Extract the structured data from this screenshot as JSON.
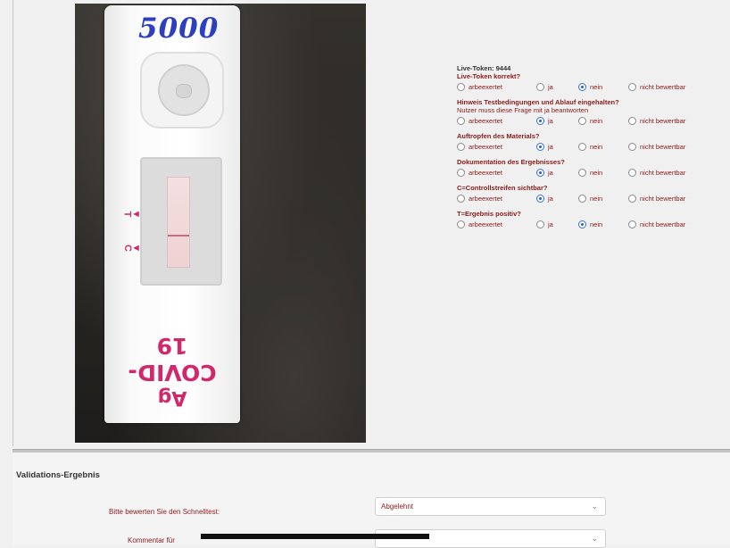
{
  "photo": {
    "handwritten_number": "5000",
    "cassette_markers": [
      "C",
      "T"
    ],
    "cassette_text_line1": "COVID-19",
    "cassette_text_line2": "Ag"
  },
  "questions": {
    "token_line": "Live-Token: 9444",
    "radio_labels": [
      "arbeexertet",
      "ja",
      "nein",
      "nicht bewertbar"
    ],
    "items": [
      {
        "title": "Live-Token korrekt?",
        "note": "",
        "selected": 2
      },
      {
        "title": "Hinweis Testbedingungen und Ablauf eingehalten?",
        "note": "Nutzer muss diese Frage mit ja beantworten",
        "selected": 1
      },
      {
        "title": "Auftropfen des Materials?",
        "note": "",
        "selected": 1
      },
      {
        "title": "Dokumentation des Ergebnisses?",
        "note": "",
        "selected": 1
      },
      {
        "title": "C=Controllstreifen sichtbar?",
        "note": "",
        "selected": 1
      },
      {
        "title": "T=Ergebnis positiv?",
        "note": "",
        "selected": 2
      }
    ]
  },
  "validation": {
    "title": "Validations-Ergebnis",
    "rate_label": "Bitte bewerten Sie den Schnelltest:",
    "rate_value": "Abgelehnt",
    "comment_label": "Kommentar für",
    "comment_value": ""
  },
  "colors": {
    "label_red": "#8b1a1a",
    "radio_blue": "#1d5fd6",
    "cassette_magenta": "#d1286b"
  }
}
